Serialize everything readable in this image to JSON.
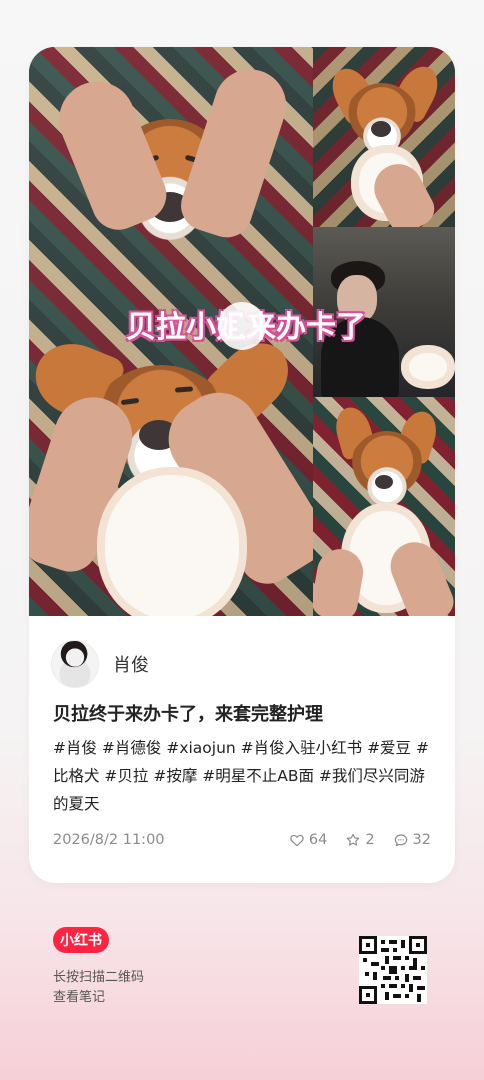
{
  "post": {
    "cover": {
      "title_overlay": "贝拉小姐来办卡了"
    },
    "author": {
      "name": "肖俊"
    },
    "title": "贝拉终于来办卡了，来套完整护理",
    "hashtags": "#肖俊 #肖德俊 #xiaojun #肖俊入驻小红书 #爱豆 #比格犬 #贝拉 #按摩 #明星不止AB面 #我们尽兴同游的夏天",
    "timestamp": "2026/8/2 11:00",
    "stats": {
      "likes": "64",
      "collects": "2",
      "comments": "32"
    }
  },
  "footer": {
    "brand": "小红书",
    "line1": "长按扫描二维码",
    "line2": "查看笔记"
  },
  "icons": {
    "play": "play-icon",
    "like": "heart-icon",
    "collect": "star-icon",
    "comment": "comment-icon",
    "qr": "qr-code-icon"
  },
  "colors": {
    "brand": "#ff2442",
    "accent_pink": "#d85097",
    "meta_gray": "#8b8b8b"
  }
}
